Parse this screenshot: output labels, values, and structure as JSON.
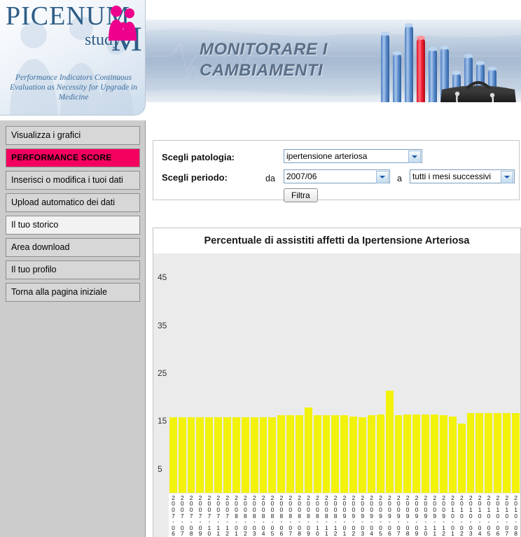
{
  "logo": {
    "name": "PICENUM",
    "study": "study",
    "m": "M",
    "tagline": "Performance Indicators Continuous Evaluation as Necessity for Upgrade  in Medicine"
  },
  "banner": {
    "line1": "MONITORARE I",
    "line2": "CAMBIAMENTI"
  },
  "sidebar": {
    "items": [
      {
        "label": "Visualizza i grafici",
        "state": "normal"
      },
      {
        "label": "PERFORMANCE SCORE",
        "state": "active"
      },
      {
        "label": "Inserisci o modifica i tuoi dati",
        "state": "normal"
      },
      {
        "label": "Upload automatico dei dati",
        "state": "normal"
      },
      {
        "label": "Il tuo storico",
        "state": "light"
      },
      {
        "label": "Area download",
        "state": "normal"
      },
      {
        "label": "Il tuo profilo",
        "state": "normal"
      },
      {
        "label": "Torna alla pagina iniziale",
        "state": "normal"
      }
    ]
  },
  "form": {
    "pathology_label": "Scegli patologia:",
    "pathology_value": "ipertensione arteriosa",
    "period_label": "Scegli periodo:",
    "from_label": "da",
    "from_value": "2007/06",
    "to_label": "a",
    "to_value": "tutti i mesi successivi",
    "filter_button": "Filtra"
  },
  "chart_data": {
    "type": "bar",
    "title": "Percentuale di assistiti affetti da Ipertensione Arteriosa",
    "xlabel": "",
    "ylabel": "",
    "ylim": [
      0,
      50
    ],
    "yticks": [
      45,
      35,
      25,
      15,
      5
    ],
    "grid": false,
    "legend": null,
    "bar_color": "#f2f20c",
    "plot_background": "#ebebeb",
    "categories": [
      "2007-06",
      "2007-07",
      "2007-08",
      "2007-09",
      "2007-10",
      "2007-11",
      "2007-12",
      "2008-01",
      "2008-02",
      "2008-03",
      "2008-04",
      "2008-05",
      "2008-06",
      "2008-07",
      "2008-08",
      "2008-09",
      "2008-10",
      "2008-11",
      "2008-12",
      "2009-01",
      "2009-02",
      "2009-03",
      "2009-04",
      "2009-05",
      "2009-06",
      "2009-07",
      "2009-08",
      "2009-09",
      "2009-10",
      "2009-11",
      "2009-12",
      "2010-01",
      "2010-02",
      "2010-03",
      "2010-04",
      "2010-05",
      "2010-06",
      "2010-07",
      "2010-08"
    ],
    "values": [
      15.8,
      15.8,
      15.8,
      15.8,
      15.8,
      15.8,
      15.8,
      15.8,
      15.8,
      15.8,
      15.8,
      15.8,
      16.2,
      16.2,
      16.2,
      17.8,
      16.2,
      16.2,
      16.2,
      16.2,
      15.9,
      15.8,
      16.2,
      16.4,
      21.3,
      16.2,
      16.4,
      16.4,
      16.4,
      16.4,
      16.2,
      15.9,
      14.5,
      16.6,
      16.6,
      16.6,
      16.6,
      16.6,
      16.6
    ]
  }
}
